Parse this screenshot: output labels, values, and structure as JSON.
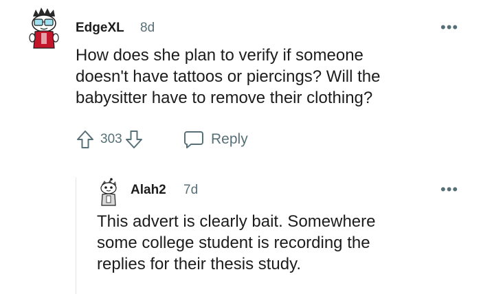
{
  "comment": {
    "username": "EdgeXL",
    "time": "8d",
    "text_lines": [
      "How does she plan to verify if someone",
      "doesn't have tattoos or piercings? Will the",
      "babysitter have to remove their clothing?"
    ],
    "score": "303",
    "reply_label": "Reply",
    "more_label": "•••",
    "avatar_icon": "snoo-avatar-icon"
  },
  "reply": {
    "username": "Alah2",
    "time": "7d",
    "text_lines": [
      "This advert is clearly bait. Somewhere",
      "some college student is recording the",
      "replies for their thesis study."
    ],
    "more_label": "•••",
    "avatar_icon": "snoo-avatar-icon"
  },
  "colors": {
    "text": "#1c1c1c",
    "meta": "#576f76",
    "thread_line": "#e2e5e7"
  }
}
